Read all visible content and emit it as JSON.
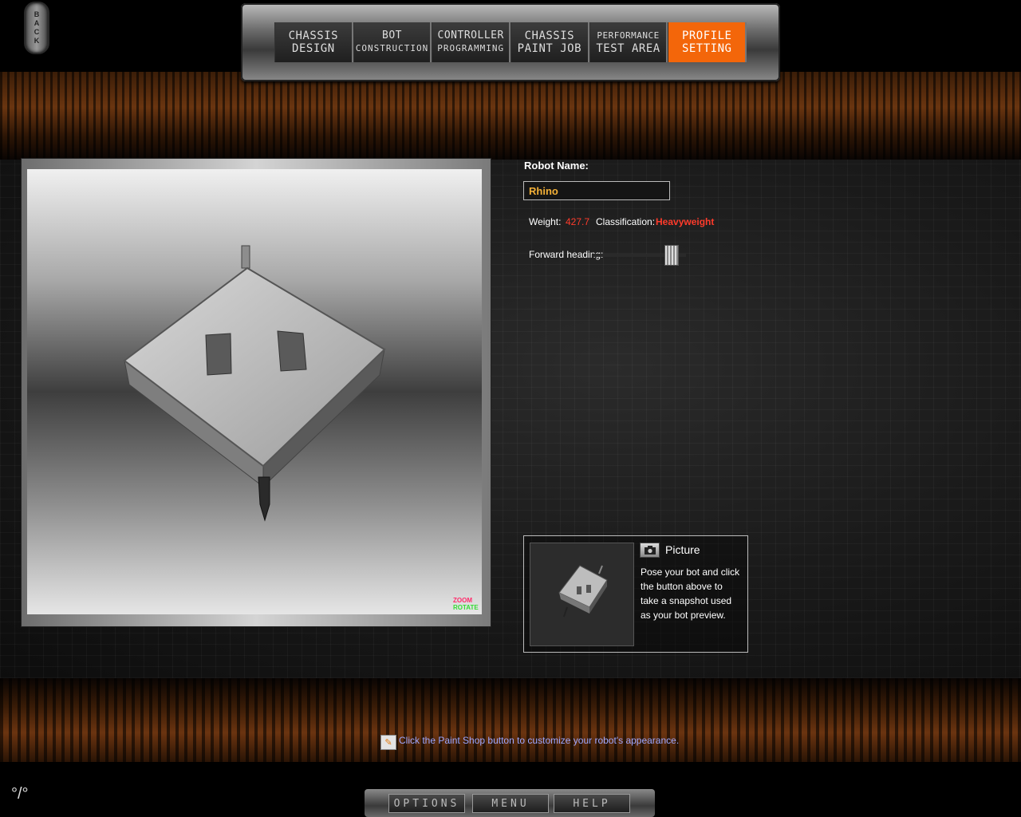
{
  "back_button": {
    "label": "BACK"
  },
  "nav": {
    "tabs": [
      {
        "line1": "CHASSIS",
        "line2": "DESIGN",
        "active": false
      },
      {
        "line1": "BOT",
        "line2": "CONSTRUCTION",
        "active": false
      },
      {
        "line1": "CONTROLLER",
        "line2": "PROGRAMMING",
        "active": false
      },
      {
        "line1": "CHASSIS",
        "line2": "PAINT JOB",
        "active": false
      },
      {
        "line1": "PERFORMANCE",
        "line2": "TEST AREA",
        "active": false
      },
      {
        "line1": "PROFILE",
        "line2": "SETTING",
        "active": true
      }
    ]
  },
  "viewport": {
    "zoom_label": "ZOOM",
    "rotate_label": "ROTATE"
  },
  "profile": {
    "name_label": "Robot Name:",
    "name_value": "Rhino",
    "weight_label": "Weight:",
    "weight_value": "427.7",
    "classification_label": "Classification:",
    "classification_value": "Heavyweight",
    "heading_label": "Forward heading:"
  },
  "picture": {
    "title": "Picture",
    "description": "Pose your bot and click the button above to take a snapshot used as your bot preview."
  },
  "tip": {
    "text": "Click the Paint Shop button to customize your robot's appearance."
  },
  "bottom_bar": {
    "options_label": "OPTIONS",
    "menu_label": "MENU",
    "help_label": "HELP"
  },
  "colors": {
    "accent": "#f3660a",
    "stat_red": "#ff3b2b",
    "name_gold": "#f3b037",
    "tip_blue": "#9ea7ff"
  }
}
